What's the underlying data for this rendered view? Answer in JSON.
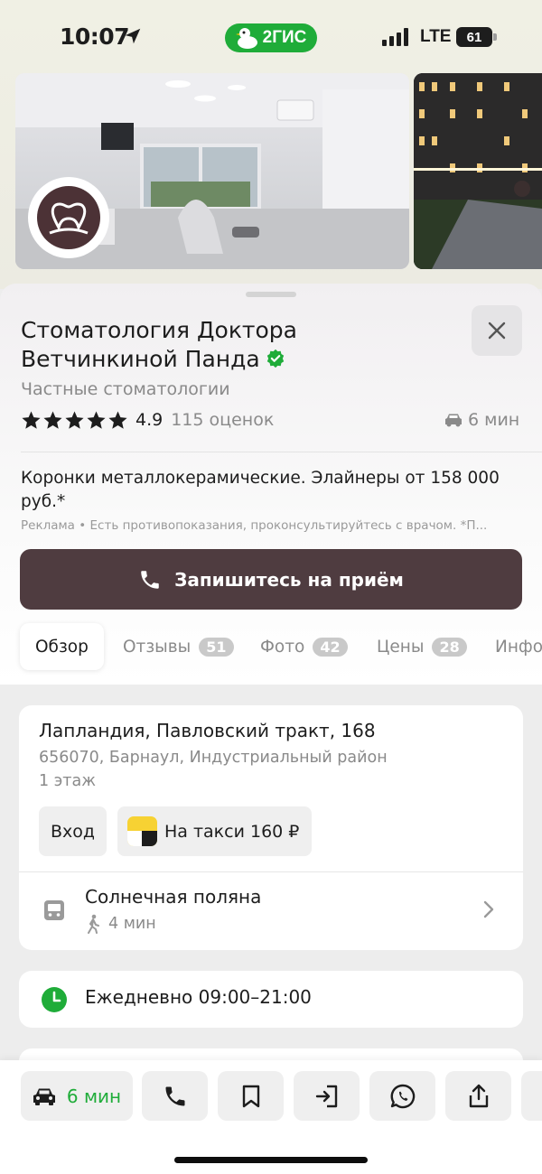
{
  "status_bar": {
    "time": "10:07",
    "app_badge": "2ГИС",
    "network": "LTE",
    "battery": "61"
  },
  "place": {
    "title": "Стоматология Доктора Ветчинкиной Панда",
    "category": "Частные стоматологии",
    "rating": "4.9",
    "rating_count": "115 оценок",
    "rating_stars": 5,
    "drive_time": "6 мин"
  },
  "ad": {
    "text": "Коронки металлокерамические. Элайнеры от 158 000 руб.*",
    "label": "Реклама",
    "disclaimer": " • Есть противопоказания, проконсультируйтесь с врачом.  *П..."
  },
  "cta": {
    "label": "Запишитесь на приём"
  },
  "tabs": [
    {
      "label": "Обзор"
    },
    {
      "label": "Отзывы",
      "count": "51"
    },
    {
      "label": "Фото",
      "count": "42"
    },
    {
      "label": "Цены",
      "count": "28"
    },
    {
      "label": "Инфо"
    }
  ],
  "address": {
    "main": "Лапландия, Павловский тракт, 168",
    "postal": "656070, Барнаул, Индустриальный район",
    "floor": "1 этаж",
    "entry_label": "Вход",
    "taxi_label": "На такси 160 ₽"
  },
  "transit": {
    "stop": "Солнечная поляна",
    "walk": "4 мин"
  },
  "hours": {
    "text": "Ежедневно 09:00–21:00"
  },
  "bottom_bar": {
    "route_label": "6 мин"
  },
  "colors": {
    "brand_green": "#1fac39",
    "cta_bg": "#4f3c40"
  }
}
